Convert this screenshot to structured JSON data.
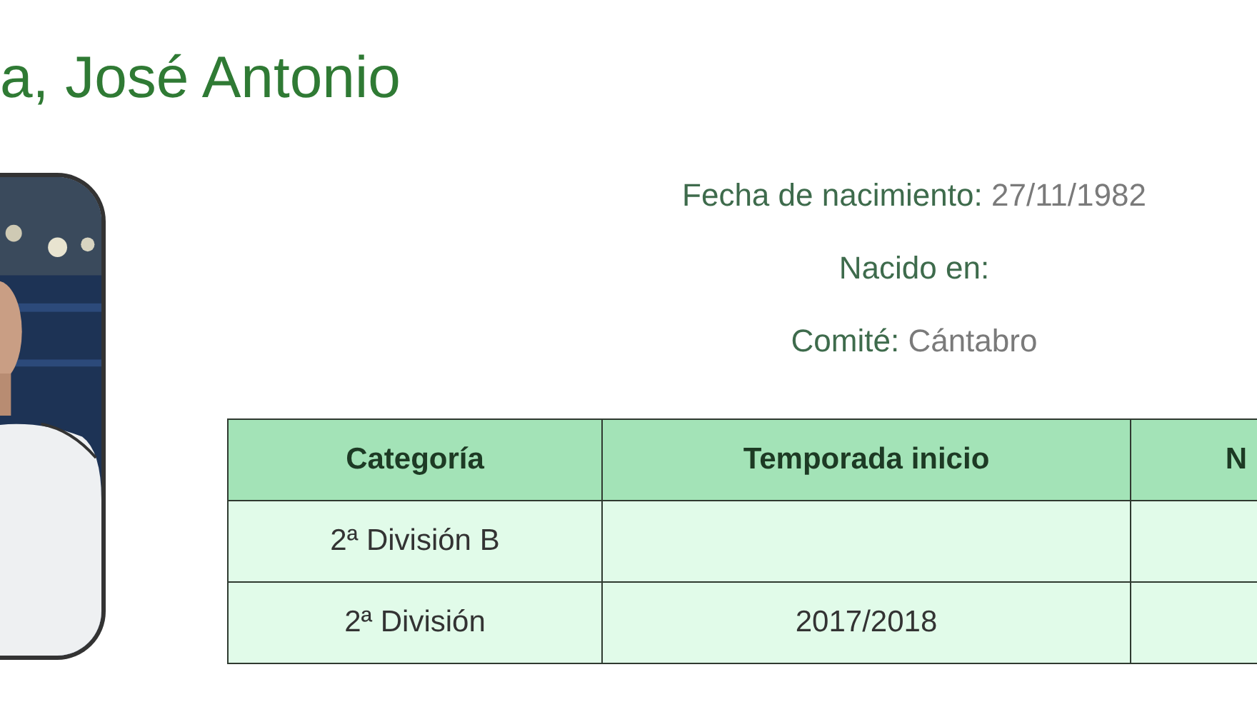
{
  "title": "a, José Antonio",
  "info": [
    {
      "label": "Fecha de nacimiento:",
      "value": "27/11/1982"
    },
    {
      "label": "Nacido en:"
    },
    {
      "label": "Comité:",
      "value": "Cántabro"
    }
  ],
  "table": {
    "columns": [
      "Categoría",
      "Temporada inicio",
      "N"
    ],
    "rows": [
      {
        "category": "2ª División B"
      },
      {
        "category": "2ª División",
        "start_season": "2017/2018"
      }
    ]
  }
}
